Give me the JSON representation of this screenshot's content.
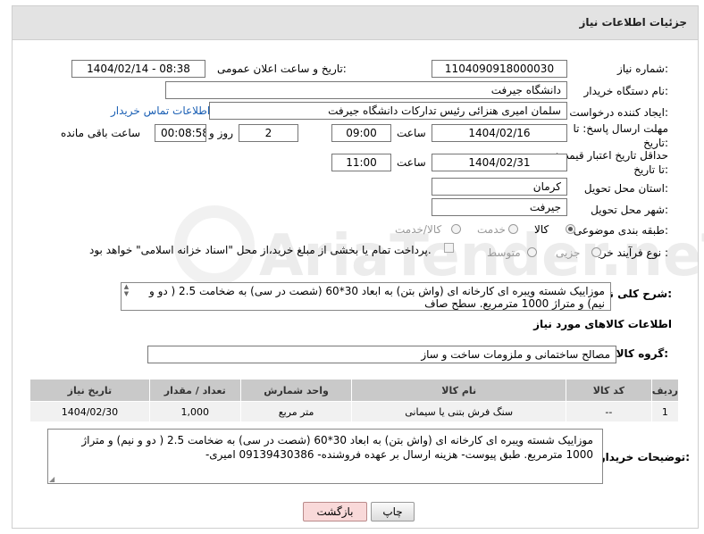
{
  "header": {
    "title": "جزئیات اطلاعات نیاز"
  },
  "form": {
    "need_number_label": "شماره نیاز:",
    "need_number": "1104090918000030",
    "announce_label": "تاریخ و ساعت اعلان عمومی:",
    "announce_value": "1404/02/14 - 08:38",
    "buyer_label": "نام دستگاه خریدار:",
    "buyer_value": "دانشگاه جیرفت",
    "creator_label": "ایجاد کننده درخواست:",
    "creator_value": "سلمان امیری هنزائی رئیس تدارکات دانشگاه جیرفت",
    "contact_link": "اطلاعات تماس خریدار",
    "deadline_label": "مهلت ارسال پاسخ: تا تاریخ:",
    "deadline_date": "1404/02/16",
    "time_label": "ساعت",
    "deadline_time": "09:00",
    "days_value": "2",
    "days_label": "روز و",
    "remaining_value": "00:08:58",
    "remaining_label": "ساعت باقی مانده",
    "validity_label": "حداقل تاریخ اعتبار قیمت: تا تاریخ:",
    "validity_date": "1404/02/31",
    "validity_time_label": "ساعت",
    "validity_time": "11:00",
    "province_label": "استان محل تحویل:",
    "province_value": "کرمان",
    "city_label": "شهر محل تحویل:",
    "city_value": "جیرفت",
    "category_label": "طبقه بندی موضوعی:",
    "category_options": [
      "کالا",
      "خدمت",
      "کالا/خدمت"
    ],
    "process_label": "نوع فرآیند خرید :",
    "process_options": [
      "جزیی",
      "متوسط"
    ],
    "payment_note": "پرداخت تمام یا بخشی از مبلغ خرید،از محل \"اسناد خزانه اسلامی\" خواهد بود."
  },
  "summary": {
    "label": "شرح کلی نیاز:",
    "text": "موزاییک شسته ویبره ای کارخانه ای (واش بتن) به ابعاد 30*60 (شصت در سی) به ضخامت 2.5 ( دو و نیم) و متراژ 1000 مترمربع. سطح صاف"
  },
  "goods": {
    "section_title": "اطلاعات کالاهای مورد نیاز",
    "group_label": "گروه کالا:",
    "group_value": "مصالح ساختمانی و ملزومات ساخت و ساز",
    "columns": [
      "ردیف",
      "کد کالا",
      "نام کالا",
      "واحد شمارش",
      "تعداد / مقدار",
      "تاریخ نیاز"
    ],
    "rows": [
      {
        "row": "1",
        "code": "--",
        "name": "سنگ فرش بتنی یا سیمانی",
        "unit": "متر مربع",
        "qty": "1,000",
        "date": "1404/02/30"
      }
    ]
  },
  "buyer_notes": {
    "label": "توضیحات خریدار:",
    "text": "موزاییک شسته ویبره ای کارخانه ای (واش بتن) به ابعاد 30*60 (شصت در سی) به ضخامت 2.5 ( دو و نیم) و متراژ 1000 مترمربع. طبق پیوست- هزینه ارسال بر عهده فروشنده- 09139430386 امیری-"
  },
  "buttons": {
    "print": "چاپ",
    "back": "بازگشت"
  },
  "watermark": "AriaTender.neT",
  "colors": {
    "link": "#1a5fb4",
    "header_bg": "#e3e3e3",
    "table_head": "#c9c9c9",
    "back_button_bg": "#f9d9d9"
  }
}
